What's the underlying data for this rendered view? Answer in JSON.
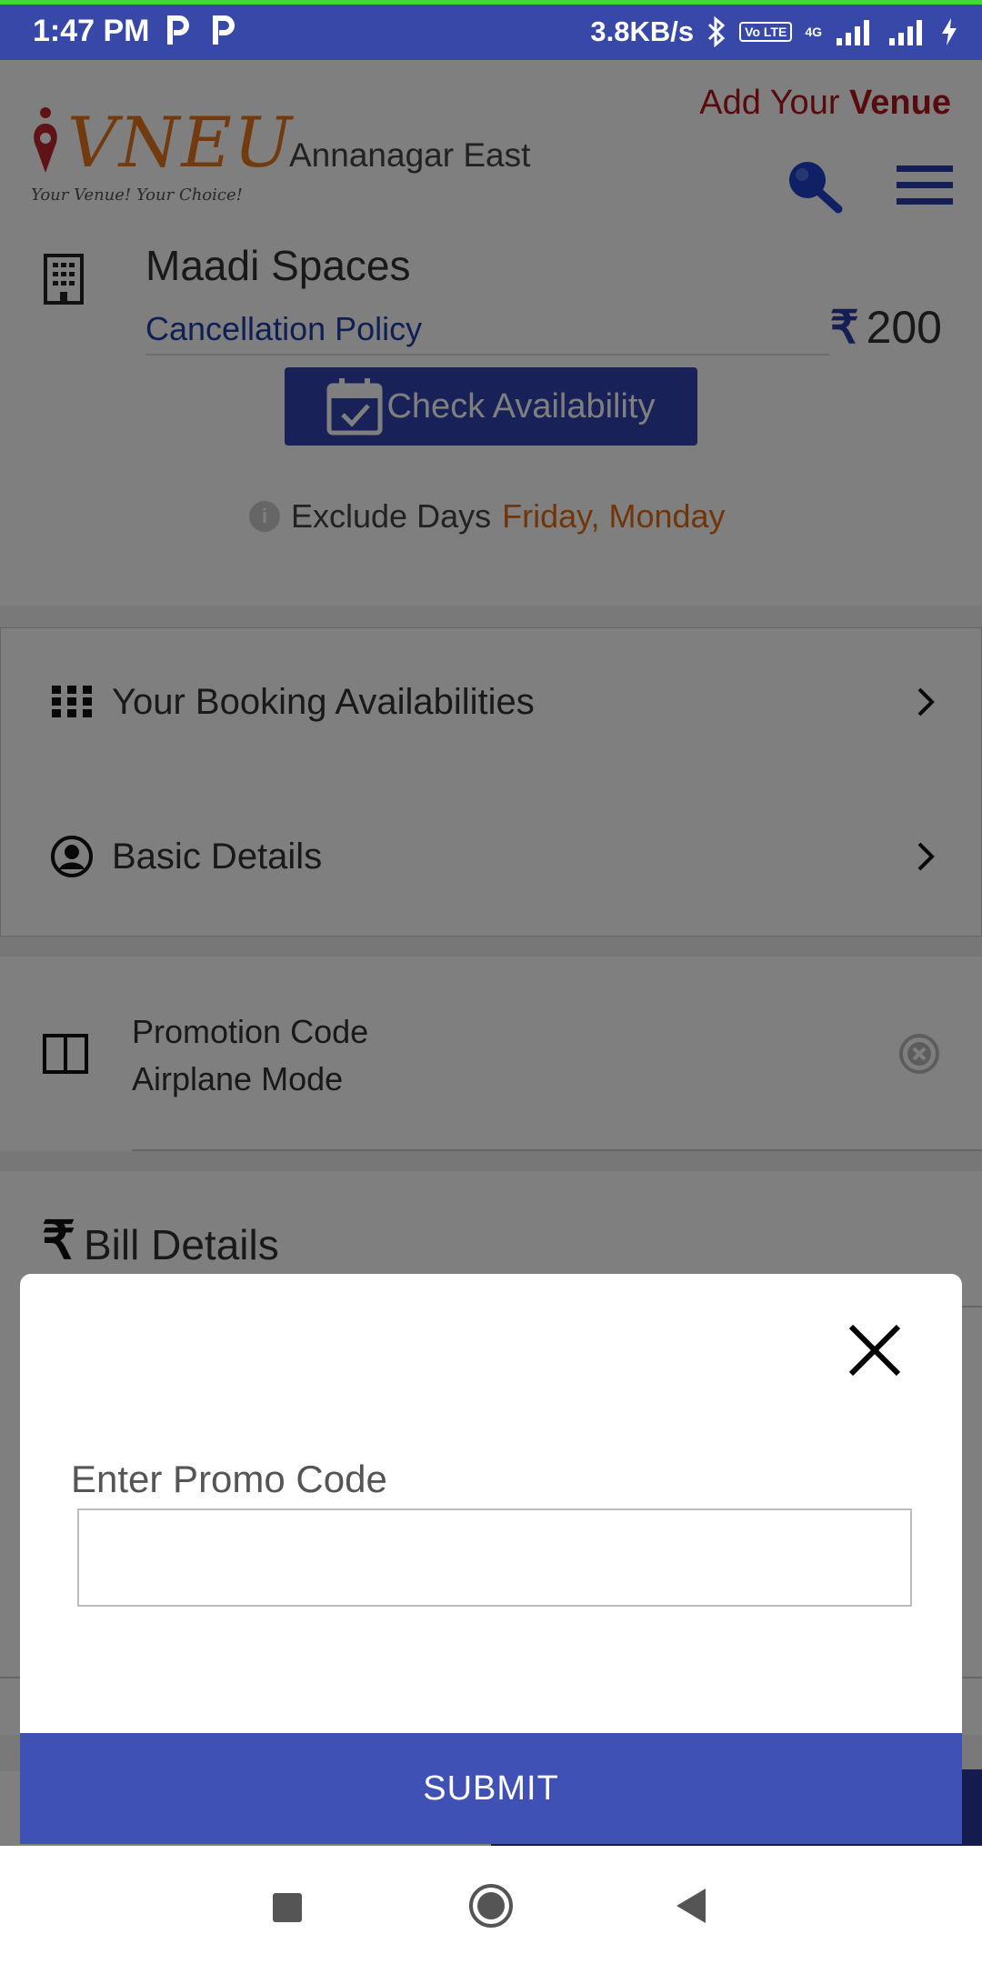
{
  "status_bar": {
    "time": "1:47 PM",
    "network_speed": "3.8KB/s",
    "volte": "Vo LTE",
    "network_type": "4G",
    "icons": [
      "parking-p-icon",
      "parking-p-icon",
      "bluetooth-icon",
      "volte-icon",
      "signal-icon",
      "signal-icon",
      "charging-icon"
    ]
  },
  "header": {
    "logo_text": "VNEU",
    "logo_tagline": "Your Venue! Your Choice!",
    "location": "Annanagar East",
    "add_venue_prefix": "Add Your",
    "add_venue_bold": "Venue",
    "accent_color": "#b0151b"
  },
  "venue": {
    "name": "Maadi Spaces",
    "cancellation_link": "Cancellation Policy",
    "price_symbol": "₹",
    "price": "200",
    "check_availability": "Check Availability",
    "exclude_label": "Exclude Days",
    "exclude_days": "Friday, Monday"
  },
  "sections": {
    "booking_availabilities": "Your Booking Availabilities",
    "basic_details": "Basic Details"
  },
  "promotion": {
    "title": "Promotion Code",
    "subtitle": "Airplane Mode"
  },
  "bill": {
    "symbol": "₹",
    "title": "Bill Details"
  },
  "modal": {
    "label": "Enter Promo Code",
    "input_value": "",
    "input_placeholder": "",
    "submit": "SUBMIT",
    "button_color": "#3f51b5"
  },
  "colors": {
    "status_bar": "#3848a8",
    "primary_button": "#3344b0",
    "link": "#1f3fa8",
    "exclude_days": "#e06a10"
  }
}
